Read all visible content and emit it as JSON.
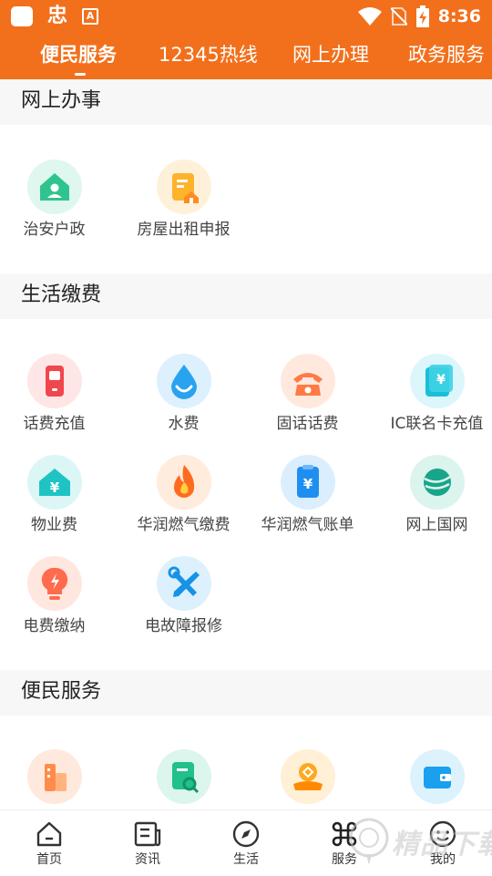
{
  "status_bar": {
    "app_glyph": "忠",
    "accessibility_glyph": "A",
    "time": "8:36"
  },
  "tabs": [
    {
      "label": "便民服务",
      "active": true
    },
    {
      "label": "12345热线",
      "active": false
    },
    {
      "label": "网上办理",
      "active": false
    },
    {
      "label": "政务服务",
      "active": false
    }
  ],
  "sections": [
    {
      "title": "网上办事",
      "items": [
        {
          "label": "治安户政",
          "icon": "police-house-icon"
        },
        {
          "label": "房屋出租申报",
          "icon": "rental-report-icon"
        }
      ]
    },
    {
      "title": "生活缴费",
      "items": [
        {
          "label": "话费充值",
          "icon": "mobile-phone-icon"
        },
        {
          "label": "水费",
          "icon": "water-drop-icon"
        },
        {
          "label": "固话话费",
          "icon": "landline-phone-icon"
        },
        {
          "label": "IC联名卡充值",
          "icon": "ic-card-icon"
        },
        {
          "label": "物业费",
          "icon": "property-fee-icon"
        },
        {
          "label": "华润燃气缴费",
          "icon": "gas-flame-icon"
        },
        {
          "label": "华润燃气账单",
          "icon": "gas-bill-icon"
        },
        {
          "label": "网上国网",
          "icon": "state-grid-icon"
        },
        {
          "label": "电费缴纳",
          "icon": "electric-bulb-icon"
        },
        {
          "label": "电故障报修",
          "icon": "repair-tools-icon"
        }
      ]
    },
    {
      "title": "便民服务",
      "items": [
        {
          "label": "",
          "icon": "buildings-icon"
        },
        {
          "label": "",
          "icon": "search-document-icon"
        },
        {
          "label": "",
          "icon": "hand-coin-icon"
        },
        {
          "label": "",
          "icon": "wallet-icon"
        }
      ]
    }
  ],
  "bottom_nav": [
    {
      "label": "首页",
      "icon": "home-icon"
    },
    {
      "label": "资讯",
      "icon": "news-icon"
    },
    {
      "label": "生活",
      "icon": "compass-icon"
    },
    {
      "label": "服务",
      "icon": "command-icon"
    },
    {
      "label": "我的",
      "icon": "profile-face-icon"
    }
  ],
  "watermark": {
    "text": "精品下载"
  },
  "colors": {
    "brand": "#f2701c",
    "section_bg": "#f7f7f7",
    "text": "#222222"
  }
}
